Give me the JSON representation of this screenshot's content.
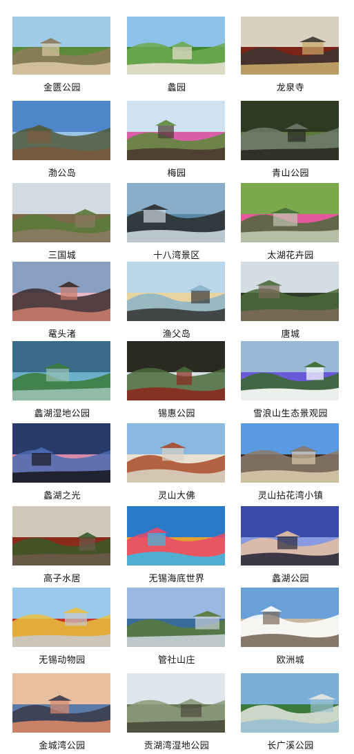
{
  "attractions": [
    {
      "name": "金匮公园",
      "palette": [
        "#9fcbe8",
        "#5d8a3a",
        "#8e7a5c",
        "#d9c7a1"
      ]
    },
    {
      "name": "蠡园",
      "palette": [
        "#8cc1e8",
        "#3f8a2f",
        "#6fa850",
        "#e8e0d0"
      ]
    },
    {
      "name": "龙泉寺",
      "palette": [
        "#d9d0c0",
        "#7a2418",
        "#3c3530",
        "#c8a86a"
      ]
    },
    {
      "name": "渤公岛",
      "palette": [
        "#4d86c9",
        "#9bc3e6",
        "#4f5a3a",
        "#7a5a3c"
      ]
    },
    {
      "name": "梅园",
      "palette": [
        "#cfe2f2",
        "#d85fa6",
        "#5c8a3a",
        "#4a3a30"
      ]
    },
    {
      "name": "青山公园",
      "palette": [
        "#2f3a22",
        "#5a7a3a",
        "#6f7a6a",
        "#2a2a22"
      ]
    },
    {
      "name": "三国城",
      "palette": [
        "#d2dbe2",
        "#7a6a4a",
        "#5a7a3a",
        "#8a7a60"
      ]
    },
    {
      "name": "十八湾景区",
      "palette": [
        "#8aaec9",
        "#5a88a8",
        "#2c2c2c",
        "#c9d6de"
      ]
    },
    {
      "name": "太湖花卉园",
      "palette": [
        "#7aa84a",
        "#e2589a",
        "#4a6a3a",
        "#c0c8b0"
      ]
    },
    {
      "name": "鼋头渚",
      "palette": [
        "#8aa0c0",
        "#e8b8c8",
        "#3a2a2a",
        "#c87a6a"
      ]
    },
    {
      "name": "渔父岛",
      "palette": [
        "#bcd6ea",
        "#e8d4a0",
        "#8ab4c8",
        "#3a3a3a"
      ]
    },
    {
      "name": "唐城",
      "palette": [
        "#d6dde2",
        "#2f3a2a",
        "#4a6a3a",
        "#7a6a5a"
      ]
    },
    {
      "name": "蠡湖湿地公园",
      "palette": [
        "#3a6a8a",
        "#6ab0c8",
        "#3a7a3a",
        "#9ac0b0"
      ]
    },
    {
      "name": "锡惠公园",
      "palette": [
        "#2a2a22",
        "#d8e2e8",
        "#4a6a3a",
        "#8a2a20"
      ]
    },
    {
      "name": "雪浪山生态景观园",
      "palette": [
        "#9ab8d8",
        "#6a5ad8",
        "#3a6a2a",
        "#ffffff"
      ]
    },
    {
      "name": "蠡湖之光",
      "palette": [
        "#2a3a6a",
        "#d88aa8",
        "#4a6ab0",
        "#1a1a22"
      ]
    },
    {
      "name": "灵山大佛",
      "palette": [
        "#8ab8e0",
        "#e8e0d0",
        "#a84a2a",
        "#d8d0c0"
      ]
    },
    {
      "name": "灵山拈花湾小镇",
      "palette": [
        "#5a9ae0",
        "#3a2a22",
        "#8a7a6a",
        "#d8c8a8"
      ]
    },
    {
      "name": "高子水居",
      "palette": [
        "#d0c8b8",
        "#8a2a1a",
        "#3a5a2a",
        "#6a5a4a"
      ]
    },
    {
      "name": "无锡海底世界",
      "palette": [
        "#2a7ac8",
        "#e8a030",
        "#e84a6a",
        "#40b8e0"
      ]
    },
    {
      "name": "蠡湖公园",
      "palette": [
        "#3a4aa8",
        "#8a9ae0",
        "#e8c0a0",
        "#2a2a3a"
      ]
    },
    {
      "name": "无锡动物园",
      "palette": [
        "#9ac8ea",
        "#c8302a",
        "#e8c040",
        "#c8c8c8"
      ]
    },
    {
      "name": "管社山庄",
      "palette": [
        "#9ab8e0",
        "#3a6a9a",
        "#5a7a3a",
        "#c8d0d8"
      ]
    },
    {
      "name": "欧洲城",
      "palette": [
        "#6aa0d8",
        "#c8b8a0",
        "#ffffff",
        "#7a6a5a"
      ]
    },
    {
      "name": "金城湾公园",
      "palette": [
        "#e8c0a0",
        "#5a7aa8",
        "#3a3a4a",
        "#d88a6a"
      ]
    },
    {
      "name": "贡湖湾湿地公园",
      "palette": [
        "#dfe6ec",
        "#6a7a5a",
        "#8a9a7a",
        "#4a4a3a"
      ]
    },
    {
      "name": "长广溪公园",
      "palette": [
        "#7ab0d8",
        "#3a7a3a",
        "#e8e8e0",
        "#9ac0d0"
      ]
    }
  ]
}
